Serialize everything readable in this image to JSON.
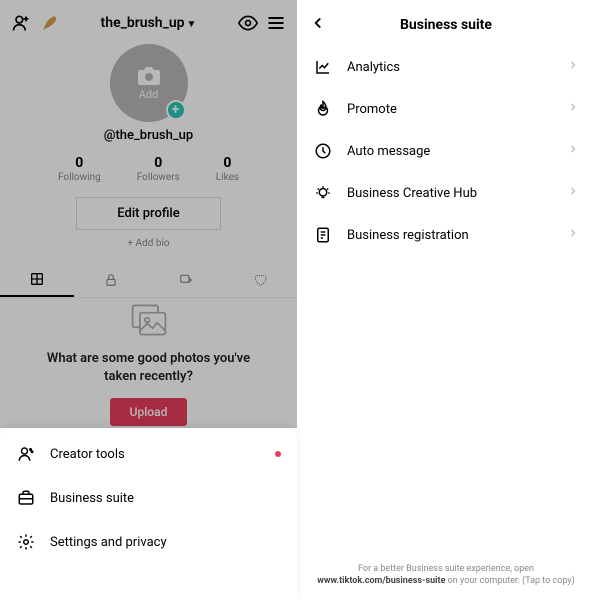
{
  "header": {
    "username": "the_brush_up"
  },
  "profile": {
    "avatar_add": "Add",
    "handle": "@the_brush_up",
    "stats": [
      {
        "num": "0",
        "label": "Following"
      },
      {
        "num": "0",
        "label": "Followers"
      },
      {
        "num": "0",
        "label": "Likes"
      }
    ],
    "edit_btn": "Edit profile",
    "add_bio": "+ Add bio"
  },
  "empty": {
    "text": "What are some good photos you've taken recently?",
    "upload": "Upload"
  },
  "sheet": {
    "items": [
      {
        "label": "Creator tools",
        "has_dot": true
      },
      {
        "label": "Business suite",
        "has_dot": false
      },
      {
        "label": "Settings and privacy",
        "has_dot": false
      }
    ]
  },
  "business": {
    "title": "Business suite",
    "items": [
      {
        "label": "Analytics"
      },
      {
        "label": "Promote"
      },
      {
        "label": "Auto message"
      },
      {
        "label": "Business Creative Hub"
      },
      {
        "label": "Business registration"
      }
    ],
    "footer_pre": "For a better Business suite experience, open ",
    "footer_url": "www.tiktok.com/business-suite",
    "footer_post": " on your computer. (Tap to copy)"
  }
}
